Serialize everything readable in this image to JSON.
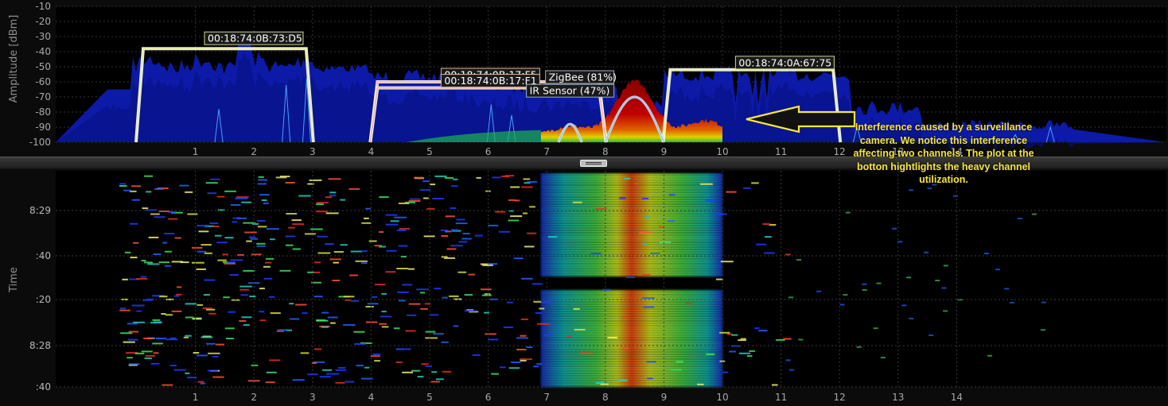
{
  "spectrum": {
    "ylabel": "Amplitude [dBm]",
    "ylim": [
      -100,
      -10
    ],
    "yticks": [
      "-10",
      "-20",
      "-30",
      "-40",
      "-50",
      "-60",
      "-70",
      "-80",
      "-90",
      "-100"
    ],
    "xticks": [
      "1",
      "2",
      "3",
      "4",
      "5",
      "6",
      "7",
      "8",
      "9",
      "10",
      "11",
      "12",
      "13",
      "14"
    ]
  },
  "waterfall": {
    "ylabel": "Time",
    "yticks": [
      "8:29",
      ":40",
      ":20",
      "8:28",
      ":40"
    ],
    "xticks": [
      "1",
      "2",
      "3",
      "4",
      "5",
      "6",
      "7",
      "8",
      "9",
      "10",
      "11",
      "12",
      "13",
      "14"
    ]
  },
  "chart_data": {
    "type": "line",
    "ylabel": "Amplitude [dBm]",
    "ylim": [
      -100,
      -10
    ],
    "xlim": [
      -0.5,
      16
    ],
    "grid": true,
    "networks": [
      {
        "name": "00:18:74:0B:73:D5",
        "x_start": 0,
        "x_end": 3,
        "top_dbm": -38,
        "color": "#e9f0a6"
      },
      {
        "name": "00:18:74:0B:17:F5",
        "x_start": 4,
        "x_end": 8,
        "top_dbm": -60,
        "color": "#f0c0a0"
      },
      {
        "name": "00:18:74:0B:17:F1",
        "x_start": 4,
        "x_end": 8,
        "top_dbm": -64,
        "color": "#f0c0a0"
      },
      {
        "name": "00:18:74:0A:67:75",
        "x_start": 9,
        "x_end": 12,
        "top_dbm": -52,
        "color": "#e9f0a6"
      }
    ],
    "interferers": [
      {
        "name": "ZigBee (81%)",
        "center": 8.5,
        "width": 1.0,
        "peak_dbm": -70,
        "color": "#8fd1f5"
      },
      {
        "name": "IR Sensor (47%)",
        "center": 7.4,
        "width": 0.4,
        "peak_dbm": -88,
        "color": "#8fd1f5"
      }
    ],
    "interference_band": [
      6.9,
      10.0
    ]
  },
  "annotation": {
    "text": "Interference caused by a surveillance camera. We notice this interference affecting two channels. The plot at the botton hightlights the heavy channel utilization.",
    "color": "#f7e63c"
  }
}
